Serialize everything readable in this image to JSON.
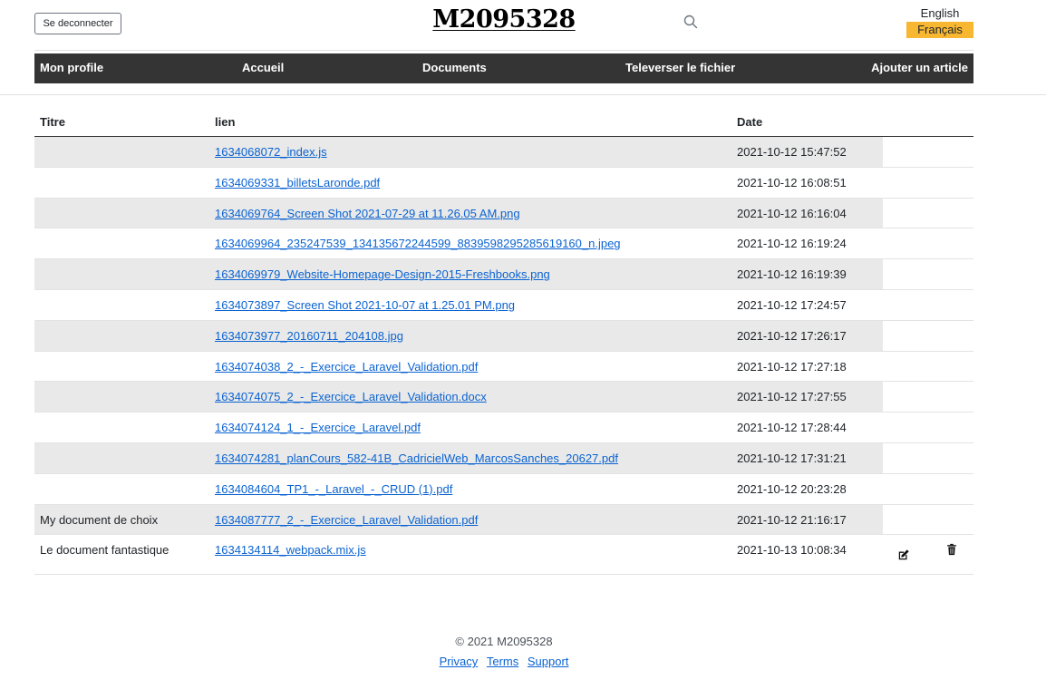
{
  "header": {
    "logout_label": "Se deconnecter",
    "site_title": "M2095328",
    "languages": [
      "English",
      "Français"
    ],
    "active_language": "Français"
  },
  "nav": {
    "items": [
      "Mon profile",
      "Accueil",
      "Documents",
      "Televerser le fichier",
      "Ajouter un article"
    ]
  },
  "table": {
    "columns": [
      "Titre",
      "lien",
      "Date"
    ],
    "rows": [
      {
        "title": "",
        "link": "1634068072_index.js",
        "date": "2021-10-12 15:47:52"
      },
      {
        "title": "",
        "link": "1634069331_billetsLaronde.pdf",
        "date": "2021-10-12 16:08:51"
      },
      {
        "title": "",
        "link": "1634069764_Screen Shot 2021-07-29 at 11.26.05 AM.png",
        "date": "2021-10-12 16:16:04"
      },
      {
        "title": "",
        "link": "1634069964_235247539_134135672244599_8839598295285619160_n.jpeg",
        "date": "2021-10-12 16:19:24"
      },
      {
        "title": "",
        "link": "1634069979_Website-Homepage-Design-2015-Freshbooks.png",
        "date": "2021-10-12 16:19:39"
      },
      {
        "title": "",
        "link": "1634073897_Screen Shot 2021-10-07 at 1.25.01 PM.png",
        "date": "2021-10-12 17:24:57"
      },
      {
        "title": "",
        "link": "1634073977_20160711_204108.jpg",
        "date": "2021-10-12 17:26:17"
      },
      {
        "title": "",
        "link": "1634074038_2_-_Exercice_Laravel_Validation.pdf",
        "date": "2021-10-12 17:27:18"
      },
      {
        "title": "",
        "link": "1634074075_2_-_Exercice_Laravel_Validation.docx",
        "date": "2021-10-12 17:27:55"
      },
      {
        "title": "",
        "link": "1634074124_1_-_Exercice_Laravel.pdf",
        "date": "2021-10-12 17:28:44"
      },
      {
        "title": "",
        "link": "1634074281_planCours_582-41B_CadricielWeb_MarcosSanches_20627.pdf",
        "date": "2021-10-12 17:31:21"
      },
      {
        "title": "",
        "link": "1634084604_TP1_-_Laravel_-_CRUD (1).pdf",
        "date": "2021-10-12 20:23:28"
      },
      {
        "title": "My document de choix",
        "link": "1634087777_2_-_Exercice_Laravel_Validation.pdf",
        "date": "2021-10-12 21:16:17"
      },
      {
        "title": "Le document fantastique",
        "link": "1634134114_webpack.mix.js",
        "date": "2021-10-13 10:08:34"
      }
    ],
    "row_actions": {
      "edit_icon": "edit-icon",
      "delete_icon": "trash-icon"
    }
  },
  "footer": {
    "copyright": "© 2021 M2095328",
    "links": [
      "Privacy",
      "Terms",
      "Support"
    ]
  },
  "colors": {
    "navbar": "#343434",
    "active_language": "#f7b731",
    "link": "#0b63d1",
    "row_shade": "#e9e9e9"
  }
}
